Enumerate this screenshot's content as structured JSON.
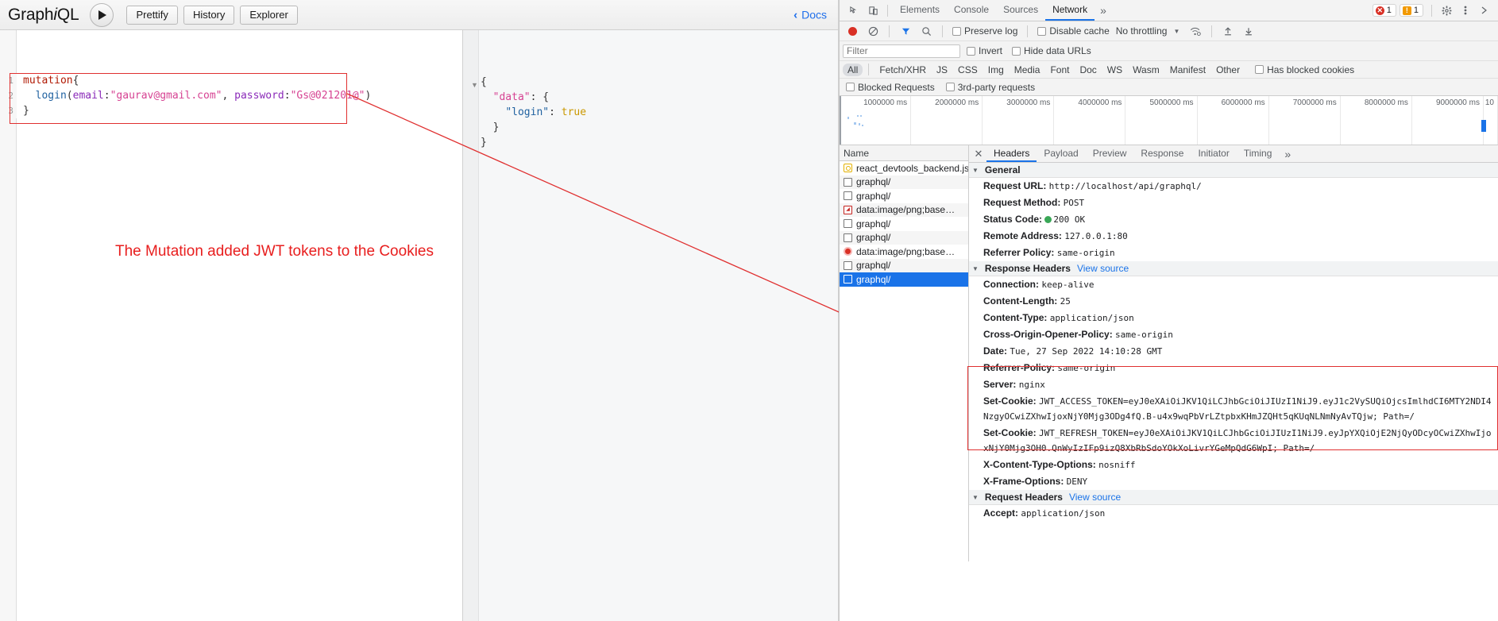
{
  "graphiql": {
    "logo_prefix": "Graph",
    "logo_italic": "i",
    "logo_suffix": "QL",
    "execute_label": "execute-query",
    "buttons": [
      "Prettify",
      "History",
      "Explorer"
    ],
    "docs_label": "Docs",
    "editor": {
      "lines": [
        {
          "no": "1",
          "tokens": [
            {
              "t": "mutation",
              "c": "kw"
            },
            {
              "t": "{",
              "c": "pun"
            }
          ]
        },
        {
          "no": "2",
          "tokens": [
            {
              "t": "  ",
              "c": "pun"
            },
            {
              "t": "login",
              "c": "fn"
            },
            {
              "t": "(",
              "c": "pun"
            },
            {
              "t": "email",
              "c": "arg"
            },
            {
              "t": ":",
              "c": "pun"
            },
            {
              "t": "\"gaurav@gmail.com\"",
              "c": "str"
            },
            {
              "t": ", ",
              "c": "pun"
            },
            {
              "t": "password",
              "c": "arg"
            },
            {
              "t": ":",
              "c": "pun"
            },
            {
              "t": "\"Gs@021201@\"",
              "c": "str"
            },
            {
              "t": ")",
              "c": "pun"
            }
          ]
        },
        {
          "no": "3",
          "tokens": [
            {
              "t": "}",
              "c": "pun"
            }
          ]
        }
      ]
    },
    "result": {
      "lines": [
        [
          {
            "t": "{",
            "c": "pun"
          }
        ],
        [
          {
            "t": "  ",
            "c": "pun"
          },
          {
            "t": "\"data\"",
            "c": "key"
          },
          {
            "t": ": {",
            "c": "pun"
          }
        ],
        [
          {
            "t": "    ",
            "c": "pun"
          },
          {
            "t": "\"login\"",
            "c": "fn"
          },
          {
            "t": ": ",
            "c": "pun"
          },
          {
            "t": "true",
            "c": "bool"
          }
        ],
        [
          {
            "t": "  }",
            "c": "pun"
          }
        ],
        [
          {
            "t": "}",
            "c": "pun"
          }
        ]
      ]
    },
    "annotation": "The Mutation added JWT tokens to the Cookies"
  },
  "devtools": {
    "tabs": [
      {
        "label": "Elements",
        "active": false
      },
      {
        "label": "Console",
        "active": false
      },
      {
        "label": "Sources",
        "active": false
      },
      {
        "label": "Network",
        "active": true
      }
    ],
    "more_tabs_glyph": "»",
    "error_count": "1",
    "warning_count": "1",
    "toolbar": {
      "record_title": "record",
      "clear_title": "clear",
      "filter_title": "filter",
      "search_title": "search",
      "preserve_log": "Preserve log",
      "disable_cache": "Disable cache",
      "throttling": "No throttling",
      "caret": "▼",
      "import_title": "import-har",
      "export_title": "export-har"
    },
    "filterbar": {
      "placeholder": "Filter",
      "value": "",
      "invert": "Invert",
      "hide_data_urls": "Hide data URLs"
    },
    "types": [
      "All",
      "Fetch/XHR",
      "JS",
      "CSS",
      "Img",
      "Media",
      "Font",
      "Doc",
      "WS",
      "Wasm",
      "Manifest",
      "Other"
    ],
    "active_type": "All",
    "has_blocked_cookies": "Has blocked cookies",
    "options": {
      "blocked_requests": "Blocked Requests",
      "third_party": "3rd-party requests"
    },
    "overview_ticks": [
      "1000000 ms",
      "2000000 ms",
      "3000000 ms",
      "4000000 ms",
      "5000000 ms",
      "6000000 ms",
      "7000000 ms",
      "8000000 ms",
      "9000000 ms",
      "10"
    ],
    "requests": {
      "column_header": "Name",
      "rows": [
        {
          "name": "react_devtools_backend.js",
          "icon": "js-file-icon",
          "selected": false
        },
        {
          "name": "graphql/",
          "icon": "doc-file-icon",
          "selected": false
        },
        {
          "name": "graphql/",
          "icon": "doc-file-icon",
          "selected": false
        },
        {
          "name": "data:image/png;base…",
          "icon": "image-file-icon",
          "selected": false
        },
        {
          "name": "graphql/",
          "icon": "doc-file-icon",
          "selected": false
        },
        {
          "name": "graphql/",
          "icon": "doc-file-icon",
          "selected": false
        },
        {
          "name": "data:image/png;base…",
          "icon": "image-error-icon",
          "selected": false
        },
        {
          "name": "graphql/",
          "icon": "doc-file-icon",
          "selected": false
        },
        {
          "name": "graphql/",
          "icon": "doc-file-icon",
          "selected": true
        }
      ]
    },
    "detail": {
      "close_glyph": "✕",
      "tabs": [
        {
          "label": "Headers",
          "active": true
        },
        {
          "label": "Payload",
          "active": false
        },
        {
          "label": "Preview",
          "active": false
        },
        {
          "label": "Response",
          "active": false
        },
        {
          "label": "Initiator",
          "active": false
        },
        {
          "label": "Timing",
          "active": false
        }
      ],
      "more_glyph": "»",
      "general": {
        "title": "General",
        "rows": [
          {
            "name": "Request URL:",
            "value": "http://localhost/api/graphql/"
          },
          {
            "name": "Request Method:",
            "value": "POST"
          },
          {
            "name": "Status Code:",
            "value": "200 OK",
            "dot": true
          },
          {
            "name": "Remote Address:",
            "value": "127.0.0.1:80"
          },
          {
            "name": "Referrer Policy:",
            "value": "same-origin"
          }
        ]
      },
      "response_headers": {
        "title": "Response Headers",
        "view_source": "View source",
        "rows": [
          {
            "name": "Connection:",
            "value": "keep-alive"
          },
          {
            "name": "Content-Length:",
            "value": "25"
          },
          {
            "name": "Content-Type:",
            "value": "application/json"
          },
          {
            "name": "Cross-Origin-Opener-Policy:",
            "value": "same-origin"
          },
          {
            "name": "Date:",
            "value": "Tue, 27 Sep 2022 14:10:28 GMT"
          },
          {
            "name": "Referrer-Policy:",
            "value": "same-origin"
          },
          {
            "name": "Server:",
            "value": "nginx"
          },
          {
            "name": "Set-Cookie:",
            "value": "JWT_ACCESS_TOKEN=eyJ0eXAiOiJKV1QiLCJhbGciOiJIUzI1NiJ9.eyJ1c2VySUQiOjcsImlhdCI6MTY2NDI4NzgyOCwiZXhwIjoxNjY0Mjg3ODg4fQ.B-u4x9wqPbVrLZtpbxKHmJZQHt5qKUqNLNmNyAvTQjw; Path=/"
          },
          {
            "name": "Set-Cookie:",
            "value": "JWT_REFRESH_TOKEN=eyJ0eXAiOiJKV1QiLCJhbGciOiJIUzI1NiJ9.eyJpYXQiOjE2NjQyODcyOCwiZXhwIjoxNjY0Mjg3OH0.QnWyIzIFp9izQ8XbRbSdoYOkXoLivrYGeMpQdG6WpI; Path=/"
          },
          {
            "name": "X-Content-Type-Options:",
            "value": "nosniff"
          },
          {
            "name": "X-Frame-Options:",
            "value": "DENY"
          }
        ]
      },
      "request_headers": {
        "title": "Request Headers",
        "view_source": "View source",
        "rows": [
          {
            "name": "Accept:",
            "value": "application/json"
          }
        ]
      }
    }
  }
}
